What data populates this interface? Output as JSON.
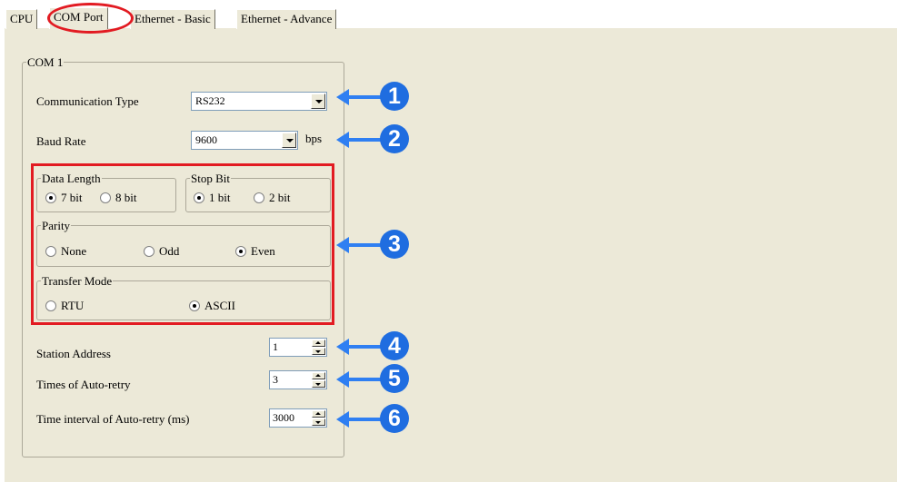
{
  "tabs": [
    {
      "label": "CPU",
      "selected": false
    },
    {
      "label": "COM Port",
      "selected": true
    },
    {
      "label": "Ethernet - Basic",
      "selected": false
    },
    {
      "label": "Ethernet - Advance",
      "selected": false
    }
  ],
  "com1": {
    "legend": "COM 1",
    "communication_type": {
      "label": "Communication Type",
      "value": "RS232"
    },
    "baud_rate": {
      "label": "Baud Rate",
      "value": "9600",
      "unit": "bps"
    },
    "data_length": {
      "legend": "Data Length",
      "options": [
        "7 bit",
        "8 bit"
      ],
      "selected": "7 bit"
    },
    "stop_bit": {
      "legend": "Stop Bit",
      "options": [
        "1 bit",
        "2 bit"
      ],
      "selected": "1 bit"
    },
    "parity": {
      "legend": "Parity",
      "options": [
        "None",
        "Odd",
        "Even"
      ],
      "selected": "Even"
    },
    "transfer_mode": {
      "legend": "Transfer Mode",
      "options": [
        "RTU",
        "ASCII"
      ],
      "selected": "ASCII"
    },
    "station_address": {
      "label": "Station Address",
      "value": "1"
    },
    "auto_retry_times": {
      "label": "Times of Auto-retry",
      "value": "3"
    },
    "auto_retry_interval": {
      "label": "Time interval of Auto-retry (ms)",
      "value": "3000"
    }
  },
  "callouts": [
    "1",
    "2",
    "3",
    "4",
    "5",
    "6"
  ],
  "colors": {
    "highlight": "#e21b22",
    "callout_blue": "#1f6de0",
    "panel": "#ece9d8"
  }
}
